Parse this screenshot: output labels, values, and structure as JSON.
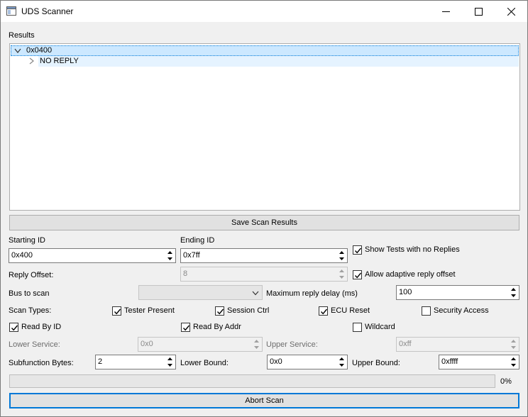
{
  "window": {
    "title": "UDS Scanner",
    "minimize_icon": "minimize-icon",
    "maximize_icon": "maximize-icon",
    "close_icon": "close-icon"
  },
  "results": {
    "label": "Results",
    "tree": [
      {
        "text": "0x0400",
        "expanded": true,
        "selected": true
      },
      {
        "text": "NO REPLY",
        "expanded": false,
        "selected": false
      }
    ]
  },
  "buttons": {
    "save": "Save Scan Results",
    "abort": "Abort Scan"
  },
  "fields": {
    "starting_id": {
      "label": "Starting ID",
      "value": "0x400"
    },
    "ending_id": {
      "label": "Ending ID",
      "value": "0x7ff"
    },
    "reply_offset": {
      "label": "Reply Offset:",
      "value": "8"
    },
    "bus_to_scan": {
      "label": "Bus to scan",
      "value": ""
    },
    "max_reply_delay": {
      "label": "Maximum reply delay (ms)",
      "value": "100"
    },
    "lower_service": {
      "label": "Lower Service:",
      "value": "0x0"
    },
    "upper_service": {
      "label": "Upper Service:",
      "value": "0xff"
    },
    "subfunction_bytes": {
      "label": "Subfunction Bytes:",
      "value": "2"
    },
    "lower_bound": {
      "label": "Lower Bound:",
      "value": "0x0"
    },
    "upper_bound": {
      "label": "Upper Bound:",
      "value": "0xffff"
    }
  },
  "checkboxes": {
    "show_no_replies": {
      "label": "Show Tests with no Replies",
      "checked": true
    },
    "adaptive_offset": {
      "label": "Allow adaptive reply offset",
      "checked": true
    },
    "scan_types_label": "Scan Types:",
    "tester_present": {
      "label": "Tester Present",
      "checked": true
    },
    "session_ctrl": {
      "label": "Session Ctrl",
      "checked": true
    },
    "ecu_reset": {
      "label": "ECU Reset",
      "checked": true
    },
    "security_access": {
      "label": "Security Access",
      "checked": false
    },
    "read_by_id": {
      "label": "Read By ID",
      "checked": true
    },
    "read_by_addr": {
      "label": "Read By Addr",
      "checked": true
    },
    "wildcard": {
      "label": "Wildcard",
      "checked": false
    }
  },
  "progress": {
    "percent_text": "0%",
    "value": 0
  },
  "colors": {
    "selection": "#cce8ff",
    "focus": "#0078d7",
    "progress": "#06b025"
  }
}
